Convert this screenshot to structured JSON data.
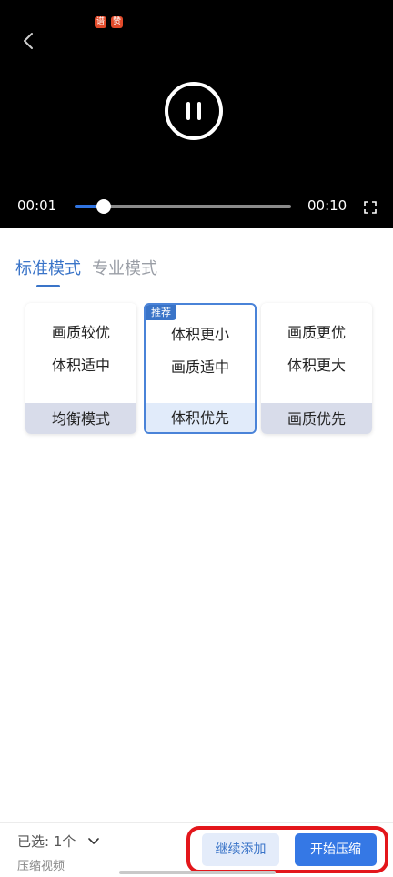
{
  "player": {
    "badges": [
      "谱",
      "赞"
    ],
    "current_time": "00:01",
    "total_time": "00:10",
    "progress_fraction": 0.1,
    "icons": {
      "back": "chevron-left-icon",
      "play_state": "pause-icon",
      "fullscreen": "fullscreen-icon"
    }
  },
  "tabs": [
    {
      "label": "标准模式",
      "active": true
    },
    {
      "label": "专业模式",
      "active": false
    }
  ],
  "options": [
    {
      "line1": "画质较优",
      "line2": "体积适中",
      "footer": "均衡模式",
      "tag": "",
      "selected": false
    },
    {
      "line1": "体积更小",
      "line2": "画质适中",
      "footer": "体积优先",
      "tag": "推荐",
      "selected": true
    },
    {
      "line1": "画质更优",
      "line2": "体积更大",
      "footer": "画质优先",
      "tag": "",
      "selected": false
    }
  ],
  "bottom_bar": {
    "selected_label": "已选: 1个",
    "subtitle": "压缩视频",
    "add_button": "继续添加",
    "start_button": "开始压缩"
  },
  "colors": {
    "accent": "#3a74c8",
    "primary_button": "#3578e5",
    "annotation_ring": "#e3161b"
  }
}
